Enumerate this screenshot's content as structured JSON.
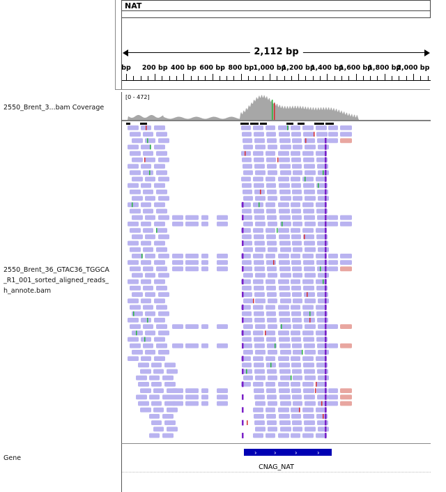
{
  "locus": {
    "name": "NAT",
    "span_label": "2,112 bp",
    "ruler_ticks": [
      {
        "label": "bp",
        "pos": 0
      },
      {
        "label": "200 bp",
        "pos": 200
      },
      {
        "label": "400 bp",
        "pos": 400
      },
      {
        "label": "600 bp",
        "pos": 600
      },
      {
        "label": "800 bp",
        "pos": 800
      },
      {
        "label": "1,000 bp",
        "pos": 1000
      },
      {
        "label": "1,200 bp",
        "pos": 1200
      },
      {
        "label": "1,400 bp",
        "pos": 1400
      },
      {
        "label": "1,600 bp",
        "pos": 1600
      },
      {
        "label": "1,800 bp",
        "pos": 1800
      },
      {
        "label": "2,000 bp",
        "pos": 2000
      }
    ]
  },
  "tracks": {
    "coverage_label": "2550_Brent_3...bam Coverage",
    "coverage_range": "[0 - 472]",
    "alignment_label_lines": [
      "2550_Brent_36_GTAC36_TGGCA",
      "_R1_001_sorted_aligned_reads_",
      "h_annote.bam"
    ],
    "gene_label": "Gene"
  },
  "gene": {
    "name": "CNAG_NAT",
    "color": "#0000b3",
    "arrow": "›"
  },
  "colors": {
    "read": "#b9b3f0",
    "read_soft": "#e8a6a0",
    "coverage": "#a7a7a7",
    "mismatch_green": "#27b43b",
    "mismatch_red": "#d62b2b",
    "insertion": "#7a1fc7"
  }
}
